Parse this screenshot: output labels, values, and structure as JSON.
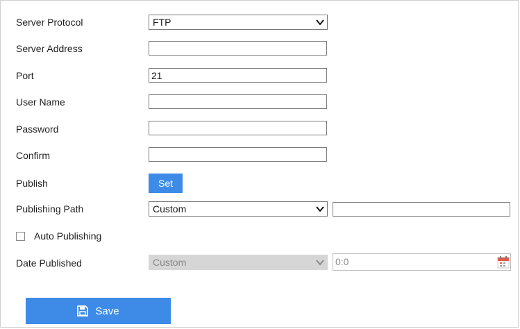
{
  "form": {
    "server_protocol": {
      "label": "Server Protocol",
      "value": "FTP"
    },
    "server_address": {
      "label": "Server Address",
      "value": ""
    },
    "port": {
      "label": "Port",
      "value": "21"
    },
    "user_name": {
      "label": "User Name",
      "value": ""
    },
    "password": {
      "label": "Password",
      "value": ""
    },
    "confirm": {
      "label": "Confirm",
      "value": ""
    },
    "publish": {
      "label": "Publish",
      "button_label": "Set"
    },
    "publishing_path": {
      "label": "Publishing Path",
      "selected": "Custom",
      "custom_value": ""
    },
    "auto_publishing": {
      "label": "Auto Publishing",
      "checked": false
    },
    "date_published": {
      "label": "Date Published",
      "selected": "Custom",
      "time_value": "0:0"
    }
  },
  "actions": {
    "save_label": "Save"
  },
  "icons": {
    "dropdown": "chevron-down-icon",
    "calendar": "calendar-icon",
    "save": "floppy-disk-icon"
  },
  "colors": {
    "accent_button": "#3d8be6",
    "disabled_select": "#d6d6d6",
    "border": "#7a7a7a"
  }
}
